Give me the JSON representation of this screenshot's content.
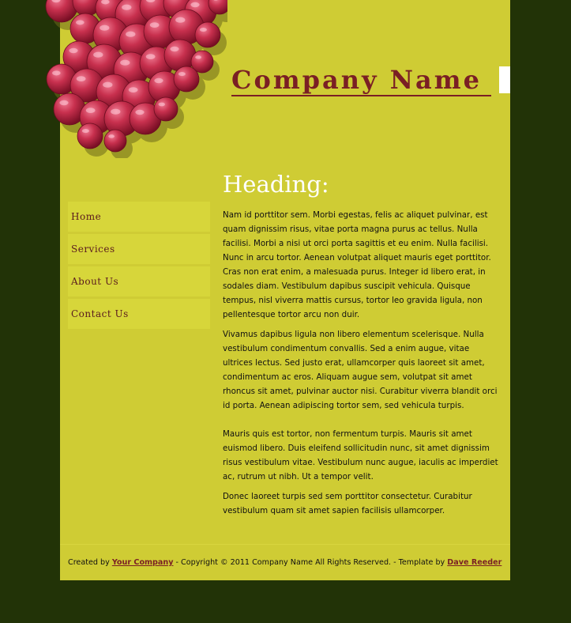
{
  "brand": {
    "company_name": "Company Name"
  },
  "nav": {
    "items": [
      {
        "label": "Home"
      },
      {
        "label": "Services"
      },
      {
        "label": "About Us"
      },
      {
        "label": "Contact Us"
      }
    ]
  },
  "main": {
    "heading": "Heading:",
    "paragraphs": [
      "Nam id porttitor sem. Morbi egestas, felis ac aliquet pulvinar, est quam dignissim risus, vitae porta magna purus ac tellus. Nulla facilisi. Morbi a nisi ut orci porta sagittis et eu enim. Nulla facilisi. Nunc in arcu tortor. Aenean volutpat aliquet mauris eget porttitor. Cras non erat enim, a malesuada purus. Integer id libero erat, in sodales diam. Vestibulum dapibus suscipit vehicula. Quisque tempus, nisl viverra mattis cursus, tortor leo gravida ligula, non pellentesque tortor arcu non duir.",
      "Vivamus dapibus ligula non libero elementum scelerisque. Nulla vestibulum condimentum convallis. Sed a enim augue, vitae ultrices lectus. Sed justo erat, ullamcorper quis laoreet sit amet, condimentum ac eros. Aliquam augue sem, volutpat sit amet rhoncus sit amet, pulvinar auctor nisi. Curabitur viverra blandit orci id porta. Aenean adipiscing tortor sem, sed vehicula turpis.",
      "Mauris quis est tortor, non fermentum turpis. Mauris sit amet euismod libero. Duis eleifend sollicitudin nunc, sit amet dignissim risus vestibulum vitae. Vestibulum nunc augue, iaculis ac imperdiet ac, rutrum ut nibh. Ut a tempor velit.",
      "Donec laoreet turpis sed sem porttitor consectetur. Curabitur vestibulum quam sit amet sapien facilisis ullamcorper."
    ]
  },
  "footer": {
    "created_by": "Created by",
    "your_company_link": "Your Company",
    "copyright": " - Copyright © 2011 Company Name All Rights Reserved. -  Template by",
    "author_link": "Dave Reeder"
  },
  "colors": {
    "background": "#223307",
    "page": "#cfcc34",
    "nav_item": "#d7d63a",
    "accent": "#7a1f24",
    "heading": "#ffffff"
  },
  "icons": {
    "header_decoration": "grapes-icon"
  }
}
